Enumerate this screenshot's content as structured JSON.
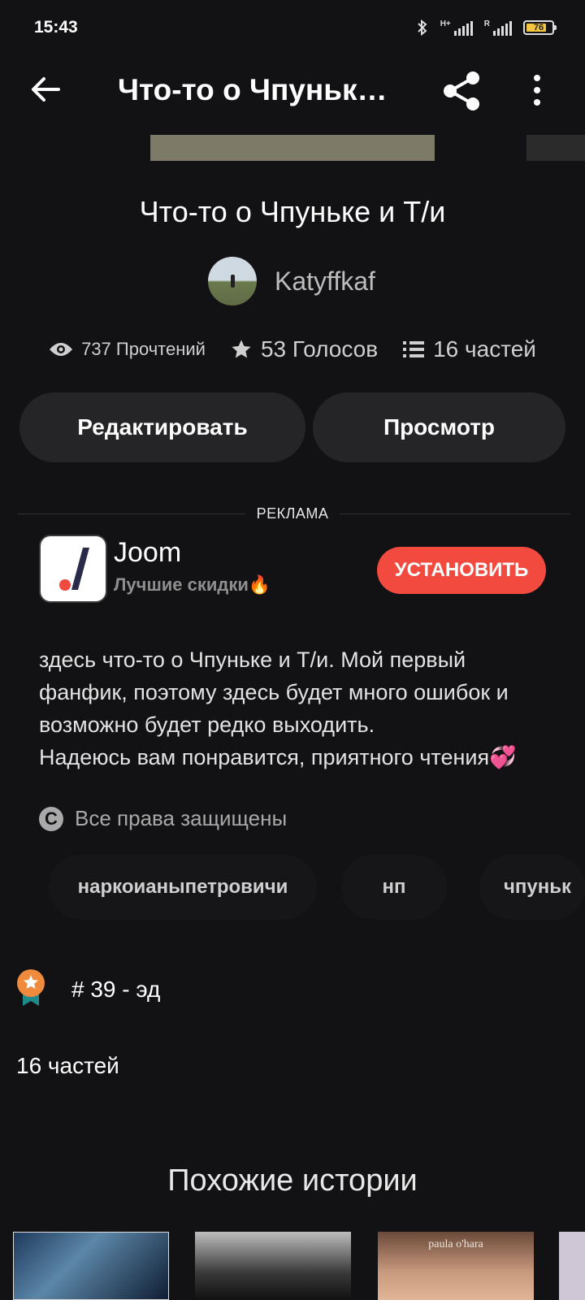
{
  "status_bar": {
    "time": "15:43",
    "net_tag_1": "H+",
    "net_tag_2": "R",
    "battery": "76"
  },
  "header": {
    "title": "Что-то о Чпуньк…"
  },
  "story": {
    "title": "Что-то о Чпуньке и Т/и",
    "author": "Katyffkaf",
    "reads": "737 Прочтений",
    "votes": "53 Голосов",
    "parts": "16 частей"
  },
  "actions": {
    "edit": "Редактировать",
    "view": "Просмотр"
  },
  "ad": {
    "label": "РЕКЛАМА",
    "app_name": "Joom",
    "app_subtitle": "Лучшие скидки🔥",
    "install": "УСТАНОВИТЬ"
  },
  "description": {
    "line1": "здесь что-то о Чпуньке и Т/и. Мой первый фанфик, поэтому здесь будет много ошибок и возможно будет редко выходить.",
    "line2": "Надеюсь вам понравится, приятного чтения💞"
  },
  "rights": "Все права защищены",
  "tags": [
    "наркоианыпетровичи",
    "нп",
    "чпуньк"
  ],
  "ranking": {
    "text": "# 39 - эд"
  },
  "parts_heading": "16 частей",
  "similar": {
    "heading": "Похожие истории",
    "thumb3_text": "paula o'hara"
  },
  "colors": {
    "accent": "#f24a3f",
    "background": "#121113",
    "button": "#252426"
  },
  "icons": [
    "back-arrow-icon",
    "share-icon",
    "more-vert-icon",
    "eye-icon",
    "star-icon",
    "list-icon",
    "copyright-icon",
    "rank-badge-icon"
  ]
}
